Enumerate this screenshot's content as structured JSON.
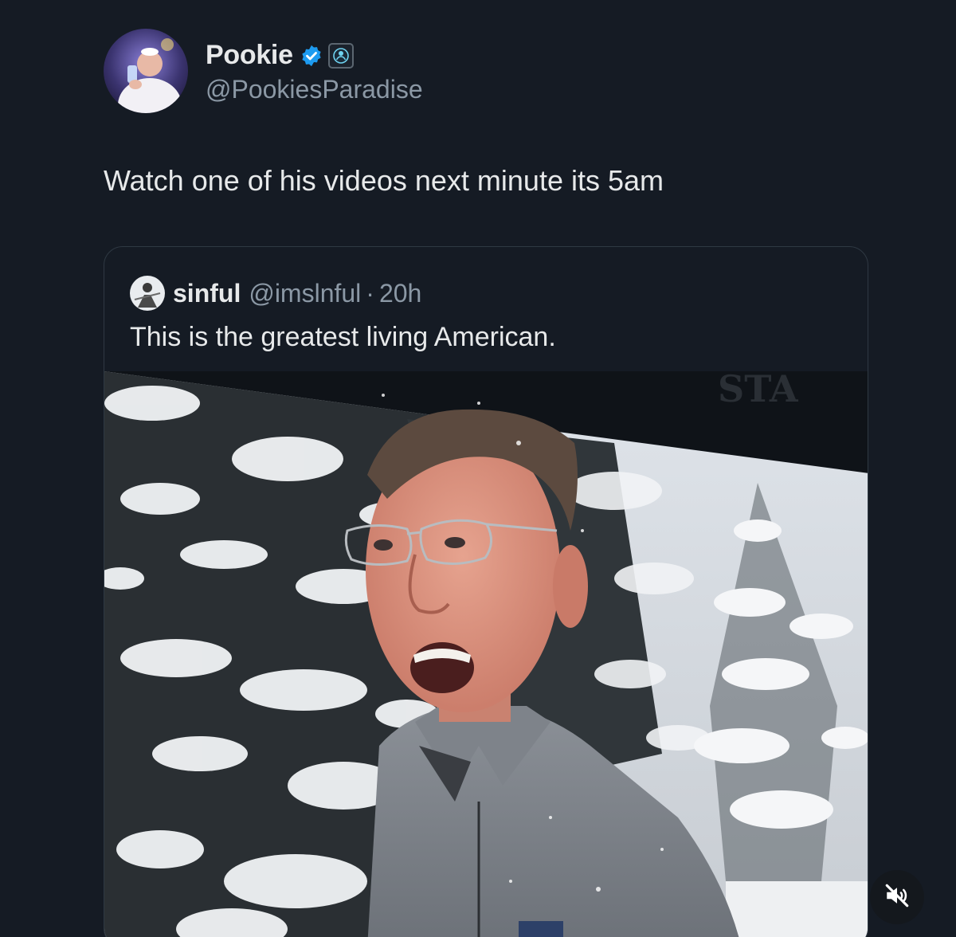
{
  "tweet": {
    "author": {
      "display_name": "Pookie",
      "handle": "@PookiesParadise",
      "verified": true,
      "verified_icon": "verified-badge-icon",
      "affiliate_icon": "affiliate-badge-icon"
    },
    "text": "Watch one of his videos next minute its 5am"
  },
  "quote": {
    "author": {
      "display_name": "sinful",
      "handle": "@imslnful",
      "separator": "·",
      "time": "20h"
    },
    "text": "This is the greatest living American.",
    "media": {
      "type": "video",
      "overlay_text": "STA",
      "mute_icon": "speaker-muted-icon"
    }
  },
  "colors": {
    "background": "#151b24",
    "text_primary": "#e7e9ea",
    "text_secondary": "#8b98a5",
    "verified_blue": "#1d9bf0",
    "border": "#2f3943"
  }
}
